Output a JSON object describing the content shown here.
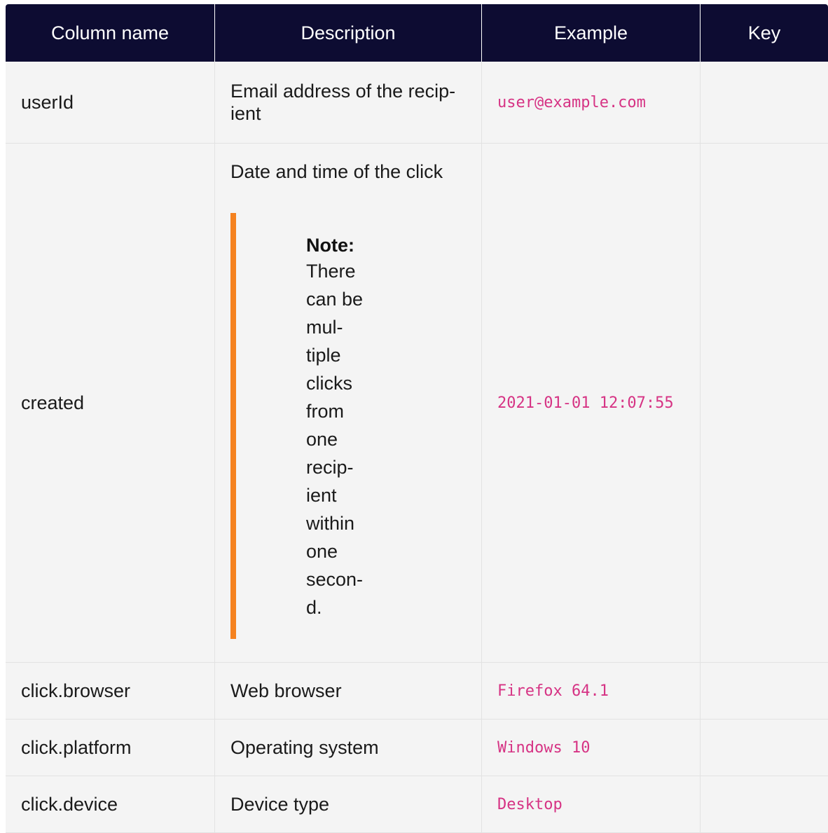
{
  "table": {
    "headers": [
      "Column name",
      "Description",
      "Example",
      "Key"
    ],
    "rows": [
      {
        "name": "userId",
        "description_lines": [
          "Email address of the recip-",
          "ient"
        ],
        "example": "user@example.com",
        "key": ""
      },
      {
        "name": "created",
        "description_lead": "Date and time of the click",
        "note_title": "Note:",
        "note_lines": [
          "There",
          "can be",
          "mul-",
          "tiple",
          "clicks",
          "from",
          "one",
          "recip-",
          "ient",
          "within",
          "one",
          "secon-",
          "d."
        ],
        "example": "2021-01-01 12:07:55",
        "key": ""
      },
      {
        "name": "click.browser",
        "description": "Web browser",
        "example": "Firefox 64.1",
        "key": ""
      },
      {
        "name": "click.platform",
        "description": "Operating system",
        "example": "Windows 10",
        "key": ""
      },
      {
        "name": "click.device",
        "description": "Device type",
        "example": "Desktop",
        "key": ""
      }
    ]
  },
  "colors": {
    "header_bg": "#0d0c32",
    "row_bg": "#f4f4f4",
    "note_accent": "#f5821f",
    "code_text": "#d63384"
  }
}
